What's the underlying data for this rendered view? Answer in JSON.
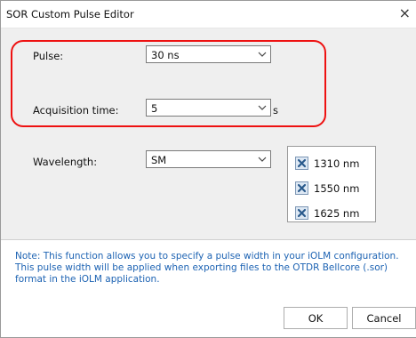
{
  "window": {
    "title": "SOR Custom Pulse Editor",
    "close_glyph": "×"
  },
  "pulse": {
    "label": "Pulse:",
    "value": "30 ns"
  },
  "acquisition": {
    "label": "Acquisition time:",
    "value": "5",
    "unit": "s"
  },
  "wavelength": {
    "label": "Wavelength:",
    "value": "SM",
    "options": [
      {
        "label": "1310 nm",
        "checked": true
      },
      {
        "label": "1550 nm",
        "checked": true
      },
      {
        "label": "1625 nm",
        "checked": true
      }
    ]
  },
  "note": "Note: This function allows you to specify a pulse width in your iOLM configuration. This pulse width will be applied when exporting files to the OTDR Bellcore (.sor) format in the iOLM application.",
  "buttons": {
    "ok": "OK",
    "cancel": "Cancel"
  },
  "colors": {
    "highlight": "#e11111",
    "note_text": "#1d63b3",
    "checkbox_mark": "#2a5a8c"
  }
}
